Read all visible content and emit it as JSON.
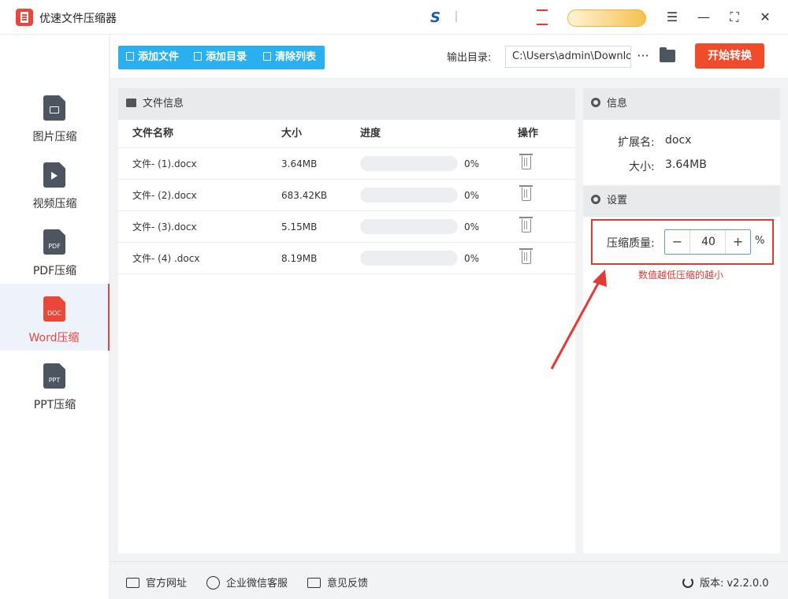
{
  "window": {
    "title": "优速文件压缩器"
  },
  "sidebar": {
    "items": [
      {
        "label": "图片压缩",
        "icon": "image-file-icon",
        "active": false
      },
      {
        "label": "视频压缩",
        "icon": "video-file-icon",
        "active": false
      },
      {
        "label": "PDF压缩",
        "icon": "pdf-file-icon",
        "icon_text": "PDF",
        "active": false
      },
      {
        "label": "Word压缩",
        "icon": "doc-file-icon",
        "icon_text": "DOC",
        "active": true
      },
      {
        "label": "PPT压缩",
        "icon": "ppt-file-icon",
        "icon_text": "PPT",
        "active": false
      }
    ]
  },
  "toolbar": {
    "add_file": "添加文件",
    "add_dir": "添加目录",
    "clear_list": "清除列表",
    "output_label": "输出目录:",
    "output_path": "C:\\Users\\admin\\Downloads",
    "more": "···",
    "start": "开始转换"
  },
  "file_panel": {
    "title": "文件信息",
    "columns": {
      "name": "文件名称",
      "size": "大小",
      "progress": "进度",
      "action": "操作"
    },
    "rows": [
      {
        "name": "文件- (1).docx",
        "size": "3.64MB",
        "progress_label": "0%",
        "progress": 0
      },
      {
        "name": "文件- (2).docx",
        "size": "683.42KB",
        "progress_label": "0%",
        "progress": 0
      },
      {
        "name": "文件- (3).docx",
        "size": "5.15MB",
        "progress_label": "0%",
        "progress": 0
      },
      {
        "name": "文件- (4) .docx",
        "size": "8.19MB",
        "progress_label": "0%",
        "progress": 0
      }
    ]
  },
  "info_panel": {
    "title": "信息",
    "ext_label": "扩展名:",
    "ext_value": "docx",
    "size_label": "大小:",
    "size_value": "3.64MB"
  },
  "settings": {
    "title": "设置",
    "quality_label": "压缩质量:",
    "quality_value": "40",
    "minus": "−",
    "plus": "+",
    "unit": "%",
    "hint": "数值越低压缩的越小"
  },
  "footer": {
    "website": "官方网址",
    "wechat": "企业微信客服",
    "feedback": "意见反馈",
    "version_label": "版本:",
    "version_value": "v2.2.0.0"
  },
  "colors": {
    "accent": "#e8473a",
    "toolbar_blue": "#2ab0f0",
    "start_button": "#f24b29",
    "annotation_red": "#e53935"
  }
}
